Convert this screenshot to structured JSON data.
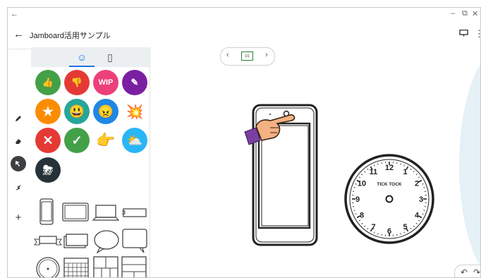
{
  "window": {
    "back_glyph": "←",
    "minimize_glyph": "–",
    "restore_glyph": "⧉",
    "close_glyph": "✕"
  },
  "app": {
    "title": "Jamboard活用サンプル",
    "back_glyph": "←",
    "present_icon": "present-icon",
    "more_glyph": "⋮"
  },
  "toolbar": {
    "add_glyph": "+"
  },
  "panel": {
    "tabs": [
      {
        "name": "stickers",
        "glyph": "☺"
      },
      {
        "name": "shapes",
        "glyph": "▯"
      }
    ],
    "stickers": [
      {
        "name": "thumbs-up",
        "color": "#43a047",
        "glyph": "👍"
      },
      {
        "name": "thumbs-down",
        "color": "#e53935",
        "glyph": "👎"
      },
      {
        "name": "wip",
        "color": "#ec407a",
        "glyph": "WIP"
      },
      {
        "name": "eraser",
        "color": "#7b1fa2",
        "glyph": "✎"
      },
      {
        "name": "star",
        "color": "#fb8c00",
        "glyph": "★"
      },
      {
        "name": "grin",
        "color": "#26a69a",
        "glyph": "😃"
      },
      {
        "name": "frown",
        "color": "#1e88e5",
        "glyph": "😠"
      },
      {
        "name": "explosion",
        "color": "#ffffff",
        "glyph": "💥"
      },
      {
        "name": "cross",
        "color": "#e53935",
        "glyph": "✕"
      },
      {
        "name": "check",
        "color": "#43a047",
        "glyph": "✓"
      },
      {
        "name": "pointing-hand",
        "color": "#ffffff",
        "glyph": "👉"
      },
      {
        "name": "partly-sunny",
        "color": "#29b6f6",
        "glyph": "⛅"
      },
      {
        "name": "thunderstorm",
        "color": "#263238",
        "glyph": "⛈"
      }
    ]
  },
  "frame_nav": {
    "prev_glyph": "‹",
    "next_glyph": "›",
    "counter": "1/1"
  },
  "canvas": {
    "clock_label": "TICK TOCK",
    "clock_numbers": [
      "12",
      "1",
      "2",
      "3",
      "4",
      "5",
      "6",
      "7",
      "8",
      "9",
      "10",
      "11"
    ]
  },
  "undo": {
    "undo_glyph": "↶",
    "redo_glyph": "↷"
  }
}
